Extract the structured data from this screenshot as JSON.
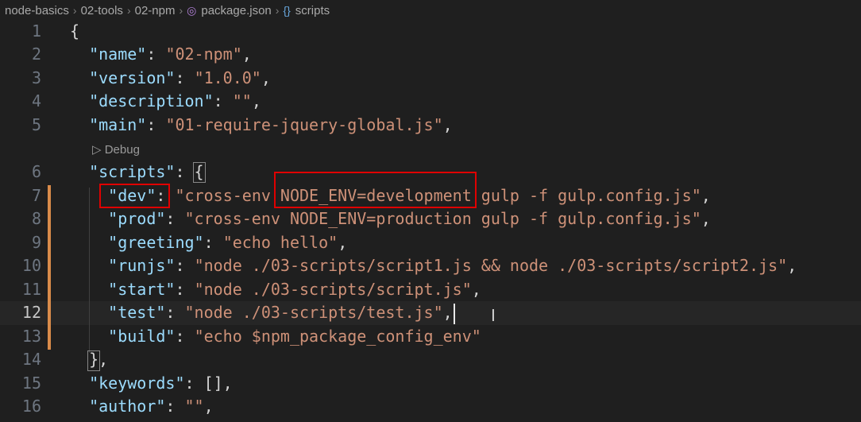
{
  "breadcrumb": {
    "items": [
      "node-basics",
      "02-tools",
      "02-npm",
      "package.json",
      "scripts"
    ]
  },
  "codelens": {
    "label": "▷ Debug"
  },
  "icons": {
    "separator": "chevron-right-icon",
    "file": "json-file-icon",
    "symbol": "curly-braces-icon"
  },
  "colors": {
    "background": "#1f1f1f",
    "key": "#9cdcfe",
    "string": "#ce9178",
    "annotation_box": "#e00000",
    "git_modified_bar": "#d98b4a"
  },
  "lines": [
    {
      "n": "1",
      "tokens": [
        [
          "p",
          "{"
        ]
      ]
    },
    {
      "n": "2",
      "tokens": [
        [
          "p",
          "  "
        ],
        [
          "k",
          "\"name\""
        ],
        [
          "p",
          ": "
        ],
        [
          "s",
          "\"02-npm\""
        ],
        [
          "p",
          ","
        ]
      ]
    },
    {
      "n": "3",
      "tokens": [
        [
          "p",
          "  "
        ],
        [
          "k",
          "\"version\""
        ],
        [
          "p",
          ": "
        ],
        [
          "s",
          "\"1.0.0\""
        ],
        [
          "p",
          ","
        ]
      ]
    },
    {
      "n": "4",
      "tokens": [
        [
          "p",
          "  "
        ],
        [
          "k",
          "\"description\""
        ],
        [
          "p",
          ": "
        ],
        [
          "s",
          "\"\""
        ],
        [
          "p",
          ","
        ]
      ]
    },
    {
      "n": "5",
      "tokens": [
        [
          "p",
          "  "
        ],
        [
          "k",
          "\"main\""
        ],
        [
          "p",
          ": "
        ],
        [
          "s",
          "\"01-require-jquery-global.js\""
        ],
        [
          "p",
          ","
        ]
      ]
    },
    {
      "n": "6",
      "tokens": [
        [
          "p",
          "  "
        ],
        [
          "k",
          "\"scripts\""
        ],
        [
          "p",
          ": {"
        ]
      ]
    },
    {
      "n": "7",
      "tokens": [
        [
          "p",
          "    "
        ],
        [
          "k",
          "\"dev\""
        ],
        [
          "p",
          ": "
        ],
        [
          "s",
          "\"cross-env NODE_ENV=development gulp -f gulp.config.js\""
        ],
        [
          "p",
          ","
        ]
      ]
    },
    {
      "n": "8",
      "tokens": [
        [
          "p",
          "    "
        ],
        [
          "k",
          "\"prod\""
        ],
        [
          "p",
          ": "
        ],
        [
          "s",
          "\"cross-env NODE_ENV=production gulp -f gulp.config.js\""
        ],
        [
          "p",
          ","
        ]
      ]
    },
    {
      "n": "9",
      "tokens": [
        [
          "p",
          "    "
        ],
        [
          "k",
          "\"greeting\""
        ],
        [
          "p",
          ": "
        ],
        [
          "s",
          "\"echo hello\""
        ],
        [
          "p",
          ","
        ]
      ]
    },
    {
      "n": "10",
      "tokens": [
        [
          "p",
          "    "
        ],
        [
          "k",
          "\"runjs\""
        ],
        [
          "p",
          ": "
        ],
        [
          "s",
          "\"node ./03-scripts/script1.js && node ./03-scripts/script2.js\""
        ],
        [
          "p",
          ","
        ]
      ]
    },
    {
      "n": "11",
      "tokens": [
        [
          "p",
          "    "
        ],
        [
          "k",
          "\"start\""
        ],
        [
          "p",
          ": "
        ],
        [
          "s",
          "\"node ./03-scripts/script.js\""
        ],
        [
          "p",
          ","
        ]
      ]
    },
    {
      "n": "12",
      "tokens": [
        [
          "p",
          "    "
        ],
        [
          "k",
          "\"test\""
        ],
        [
          "p",
          ": "
        ],
        [
          "s",
          "\"node ./03-scripts/test.js\""
        ],
        [
          "p",
          ","
        ]
      ]
    },
    {
      "n": "13",
      "tokens": [
        [
          "p",
          "    "
        ],
        [
          "k",
          "\"build\""
        ],
        [
          "p",
          ": "
        ],
        [
          "s",
          "\"echo $npm_package_config_env\""
        ]
      ]
    },
    {
      "n": "14",
      "tokens": [
        [
          "p",
          "  },"
        ]
      ]
    },
    {
      "n": "15",
      "tokens": [
        [
          "p",
          "  "
        ],
        [
          "k",
          "\"keywords\""
        ],
        [
          "p",
          ": [],"
        ]
      ]
    },
    {
      "n": "16",
      "tokens": [
        [
          "p",
          "  "
        ],
        [
          "k",
          "\"author\""
        ],
        [
          "p",
          ": "
        ],
        [
          "s",
          "\"\""
        ],
        [
          "p",
          ","
        ]
      ]
    }
  ]
}
